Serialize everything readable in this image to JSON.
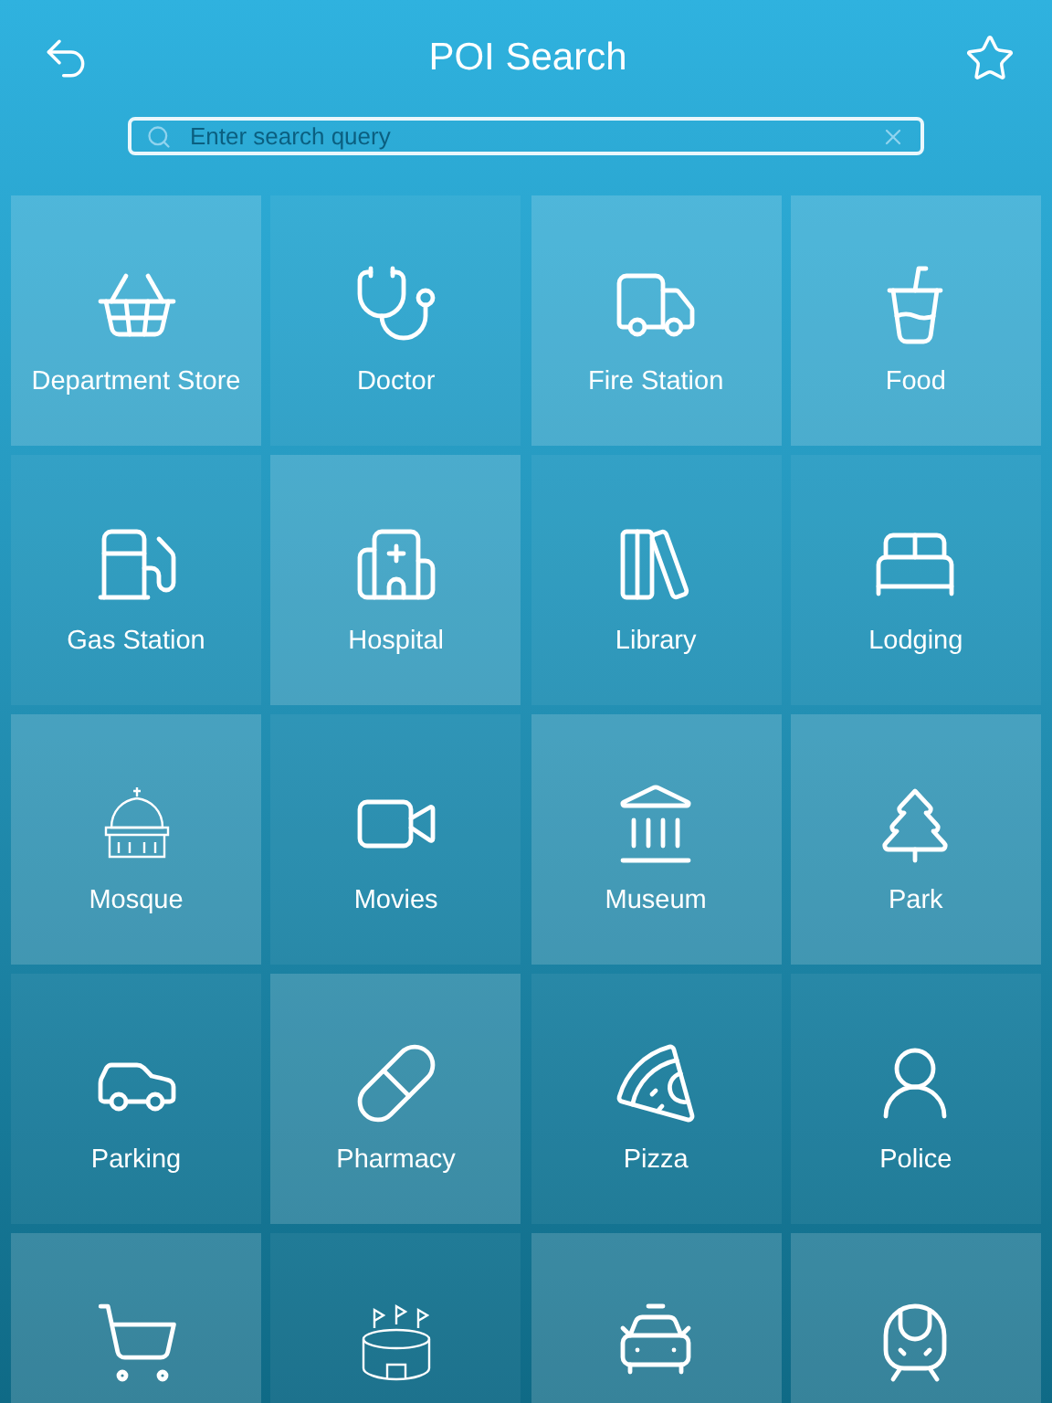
{
  "header": {
    "title": "POI Search"
  },
  "search": {
    "placeholder": "Enter search query"
  },
  "tiles": [
    {
      "label": "Department Store",
      "highlighted": true
    },
    {
      "label": "Doctor",
      "highlighted": false
    },
    {
      "label": "Fire Station",
      "highlighted": true
    },
    {
      "label": "Food",
      "highlighted": true
    },
    {
      "label": "Gas Station",
      "highlighted": false
    },
    {
      "label": "Hospital",
      "highlighted": true
    },
    {
      "label": "Library",
      "highlighted": false
    },
    {
      "label": "Lodging",
      "highlighted": false
    },
    {
      "label": "Mosque",
      "highlighted": true
    },
    {
      "label": "Movies",
      "highlighted": false
    },
    {
      "label": "Museum",
      "highlighted": true
    },
    {
      "label": "Park",
      "highlighted": true
    },
    {
      "label": "Parking",
      "highlighted": false
    },
    {
      "label": "Pharmacy",
      "highlighted": true
    },
    {
      "label": "Pizza",
      "highlighted": false
    },
    {
      "label": "Police",
      "highlighted": false
    },
    {
      "highlighted": true
    },
    {
      "highlighted": false
    },
    {
      "highlighted": true
    },
    {
      "highlighted": true
    }
  ]
}
